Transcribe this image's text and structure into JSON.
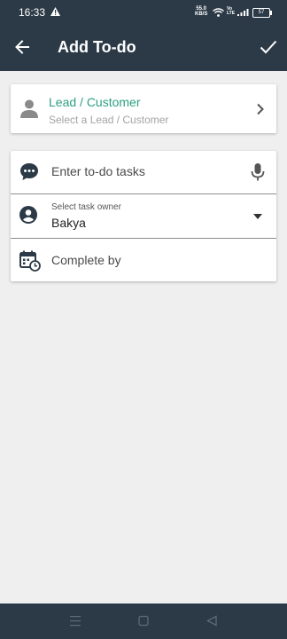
{
  "status_bar": {
    "time": "16:33",
    "network_speed_value": "55.0",
    "network_speed_unit": "KB/S",
    "volte_line1": "Vo",
    "volte_line2": "LTE",
    "battery": "57"
  },
  "app_bar": {
    "title": "Add To-do",
    "back_icon": "arrow-left-icon",
    "confirm_icon": "check-icon"
  },
  "lead_card": {
    "title": "Lead / Customer",
    "subtitle": "Select a Lead / Customer",
    "icon": "person-icon",
    "title_color": "#2d9f82"
  },
  "form": {
    "task_placeholder": "Enter to-do tasks",
    "owner_label": "Select task owner",
    "owner_value": "Bakya",
    "complete_by": "Complete by"
  },
  "colors": {
    "bar_background": "#2c3a47",
    "page_background": "#efefef",
    "accent": "#2d9f82"
  },
  "nav_bar": {
    "icons": [
      "menu-icon",
      "home-square-icon",
      "back-triangle-icon"
    ]
  }
}
